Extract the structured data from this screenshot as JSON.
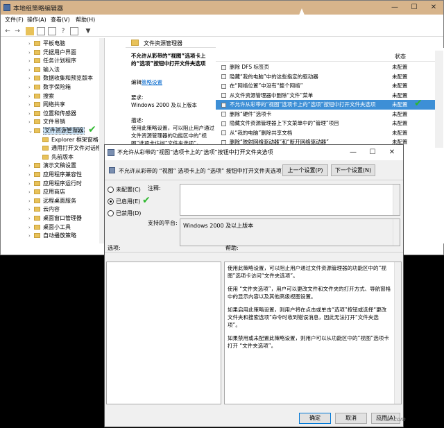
{
  "main_window": {
    "title": "本地组策略编辑器",
    "controls": {
      "minimize": "—",
      "maximize": "☐",
      "close": "✕"
    }
  },
  "menu": [
    "文件(F)",
    "操作(A)",
    "查看(V)",
    "帮助(H)"
  ],
  "tree": {
    "items": [
      {
        "label": "平板电脑",
        "indent": 1,
        "expanded": false
      },
      {
        "label": "凭据用户界面",
        "indent": 1,
        "expanded": false
      },
      {
        "label": "任务计划程序",
        "indent": 1,
        "expanded": false
      },
      {
        "label": "输入法",
        "indent": 1,
        "expanded": false
      },
      {
        "label": "数据收集和预览版本",
        "indent": 1,
        "expanded": false
      },
      {
        "label": "数字保险箱",
        "indent": 1,
        "expanded": false
      },
      {
        "label": "搜索",
        "indent": 1,
        "expanded": false
      },
      {
        "label": "网络共享",
        "indent": 1,
        "expanded": false
      },
      {
        "label": "位置和传感器",
        "indent": 1,
        "expanded": false
      },
      {
        "label": "文件吊销",
        "indent": 1,
        "expanded": false
      },
      {
        "label": "文件资源管理器",
        "indent": 1,
        "expanded": true,
        "selected": true
      },
      {
        "label": "Explorer 框架窗格",
        "indent": 2,
        "expanded": false
      },
      {
        "label": "通用打开文件对话框",
        "indent": 2,
        "expanded": false
      },
      {
        "label": "先前版本",
        "indent": 2,
        "expanded": false
      },
      {
        "label": "演示文稿设置",
        "indent": 1,
        "expanded": false
      },
      {
        "label": "应用程序兼容性",
        "indent": 1,
        "expanded": false
      },
      {
        "label": "应用程序运行时",
        "indent": 1,
        "expanded": false
      },
      {
        "label": "应用商店",
        "indent": 1,
        "expanded": false
      },
      {
        "label": "远程桌面服务",
        "indent": 1,
        "expanded": false
      },
      {
        "label": "云内容",
        "indent": 1,
        "expanded": false
      },
      {
        "label": "桌面窗口管理器",
        "indent": 1,
        "expanded": false
      },
      {
        "label": "桌面小工具",
        "indent": 1,
        "expanded": false
      },
      {
        "label": "自动播放策略",
        "indent": 1,
        "expanded": false
      }
    ]
  },
  "mid_panel": {
    "header": "文件资源管理器",
    "policy_title": "不允许从彩带的“视图”选项卡上的“选项”按钮中打开文件夹选项",
    "edit_prefix": "编辑",
    "edit_link": "策略设置",
    "requirements_label": "要求:",
    "requirements_value": "Windows 2000 及以上版本",
    "description_label": "描述:",
    "description_text": "使用此策略设置，可以阻止用户通过文件资源管理器的功能区中的“视图”选项卡访问“文件夹选项”。"
  },
  "list": {
    "status_header": "状态",
    "rows": [
      {
        "name": "删除 DFS 标签页",
        "state": "未配置"
      },
      {
        "name": "隐藏“我的电脑”中的这些指定的驱动器",
        "state": "未配置"
      },
      {
        "name": "在“网络位置”中没有“整个网络”",
        "state": "未配置"
      },
      {
        "name": "从文件资源管理器中删除“文件”菜单",
        "state": "未配置"
      },
      {
        "name": "不允许从彩带的“视图”选项卡上的“选项”按钮中打开文件夹选项",
        "state": "未配置",
        "selected": true
      },
      {
        "name": "删除“硬件”选项卡",
        "state": "未配置"
      },
      {
        "name": "隐藏文件资源管理器上下文菜单中的“管理”项目",
        "state": "未配置"
      },
      {
        "name": "从“我的电脑”删除共享文档",
        "state": "未配置"
      },
      {
        "name": "删除“映射网络驱动器”和“断开网络驱动器”",
        "state": "未配置"
      }
    ]
  },
  "dialog": {
    "title": "不允许从彩带的“视图”选项卡上的“选项”按钮中打开文件夹选项",
    "controls": {
      "minimize": "—",
      "maximize": "☐",
      "close": "✕"
    },
    "policy_name": "不允许从彩带的 “视图” 选项卡上的 “选项” 按钮中打开文件夹选项",
    "prev_button": "上一个设置(P)",
    "next_button": "下一个设置(N)",
    "radio_not_configured": "未配置(C)",
    "radio_enabled": "已启用(E)",
    "radio_disabled": "已禁用(D)",
    "selected_radio": "enabled",
    "comment_label": "注释:",
    "supported_label": "支持的平台:",
    "supported_value": "Windows 2000 及以上版本",
    "options_label": "选项:",
    "help_label": "帮助:",
    "help_paragraphs": [
      "使用此策略设置，可以阻止用户通过文件资源管理器的功能区中的“视图”选项卡访问“文件夹选项”。",
      "使用 “文件夹选项”，用户可以更改文件和文件夹的打开方式、导航窗格中的显示内容以及其他高级视图设置。",
      "如果启用此策略设置，则用户将在点击或单击“选项”按钮或选择“更改文件夹和搜索选项”命令时收到错误消息，因此无法打开“文件夹选项”。",
      "如果禁用或未配置此策略设置，则用户可以从功能区中的“视图”选项卡打开 “文件夹选项”。"
    ],
    "ok_button": "确定",
    "cancel_button": "取消",
    "apply_button": "应用(A)"
  },
  "watermark": "cfan.com",
  "colors": {
    "title_bar": "#d7b48b",
    "selection": "#3d8fd6",
    "check": "#2db82d"
  }
}
